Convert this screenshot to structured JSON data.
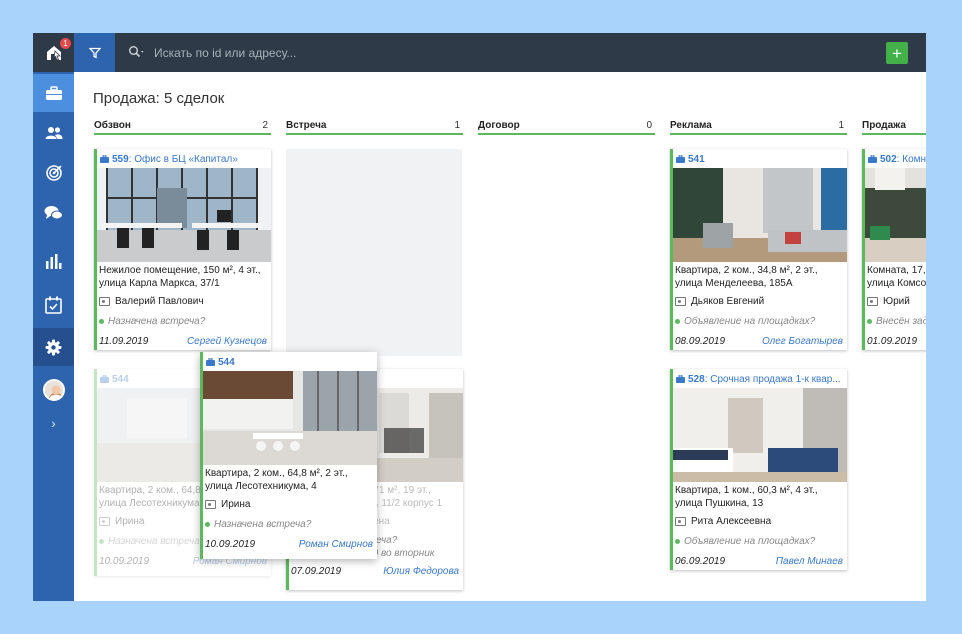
{
  "colors": {
    "accent": "#2e63ae",
    "success": "#5cb85c",
    "link": "#3a78c9",
    "dark": "#2e3a47"
  },
  "logo": {
    "badge": "1"
  },
  "sidebar": {
    "items": [
      "briefcase-icon",
      "users-icon",
      "target-icon",
      "chat-icon",
      "bar-chart-icon",
      "calendar-check-icon",
      "gear-icon",
      "avatar",
      "chevron-right-icon"
    ],
    "active": "briefcase-icon",
    "expand_label": "›"
  },
  "topbar": {
    "search_placeholder": "Искать по id или адресу...",
    "add_label": "+"
  },
  "page": {
    "title": "Продажа: 5 сделок"
  },
  "columns": [
    {
      "name": "Обзвон",
      "count": "2"
    },
    {
      "name": "Встреча",
      "count": "1"
    },
    {
      "name": "Договор",
      "count": "0"
    },
    {
      "name": "Реклама",
      "count": "1"
    },
    {
      "name": "Продажа",
      "count": ""
    }
  ],
  "cards": [
    {
      "id": "559",
      "title": ": Офис в БЦ «Капитал»",
      "desc1": "Нежилое помещение, 150 м², 4 эт.,",
      "desc2": "улица Карла Маркса, 37/1",
      "person": "Валерий Павлович",
      "status": "Назначена встреча?",
      "date": "11.09.2019",
      "manager": "Сергей Кузнецов"
    },
    {
      "id": "544",
      "title": "",
      "desc1": "Квартира, 2 ком., 64,8 м², 2 эт.,",
      "desc2": "улица Лесотехникума, 4",
      "person": "Ирина",
      "status": "Назначена встреча?",
      "date": "10.09.2019",
      "manager": "Роман Смирнов"
    },
    {
      "id": "",
      "title": "",
      "desc1": "Квартира, 3 ком., 71 м², 19 эт.,",
      "desc2": "ул. наб. Реки Уфы, 11/2 корпус 1",
      "person": "Никитова Милена",
      "status": "Назначена встреча?",
      "status2": "позвонить в 12-00 во вторник",
      "date": "07.09.2019",
      "manager": "Юлия Федорова"
    },
    {
      "id": "541",
      "title": "",
      "desc1": "Квартира, 2 ком., 34,8 м², 2 эт.,",
      "desc2": "улица Менделеева, 185А",
      "person": "Дьяков Евгений",
      "status": "Объявление на площадках?",
      "date": "08.09.2019",
      "manager": "Олег Богатырев"
    },
    {
      "id": "528",
      "title": ": Срочная продажа 1-к квар...",
      "desc1": "Квартира, 1 ком., 60,3 м², 4 эт.,",
      "desc2": "улица Пушкина, 13",
      "person": "Рита Алексеевна",
      "status": "Объявление на площадках?",
      "date": "06.09.2019",
      "manager": "Павел Минаев"
    },
    {
      "id": "502",
      "title": ": Комн",
      "desc1": "Комната, 17,",
      "desc2": "улица Комсо",
      "person": "Юрий",
      "status": "Внесён зад",
      "date": "01.09.2019",
      "manager": ""
    }
  ]
}
